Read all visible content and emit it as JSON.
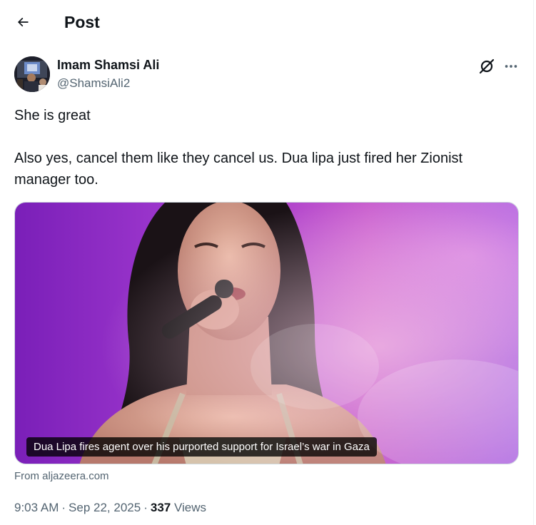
{
  "header": {
    "title": "Post",
    "back_icon": "arrow-left-icon"
  },
  "author": {
    "name": "Imam Shamsi Ali",
    "handle": "@ShamsiAli2"
  },
  "actions": {
    "grok_icon": "grok-icon",
    "more_icon": "more-horizontal-icon"
  },
  "tweet": {
    "line1": "She is great",
    "line2": "Also yes, cancel them like they cancel us. Dua lipa just fired her Zionist manager too."
  },
  "card": {
    "caption": "Dua Lipa fires agent over his purported support for Israel’s war in Gaza",
    "source": "From aljazeera.com"
  },
  "meta": {
    "time": "9:03 AM",
    "separator": "·",
    "date": "Sep 22, 2025",
    "views_count": "337",
    "views_label": "Views"
  },
  "colors": {
    "text_primary": "#0f1419",
    "text_secondary": "#536471",
    "border": "#cfd9de",
    "photo_background": "#b04ad8"
  }
}
